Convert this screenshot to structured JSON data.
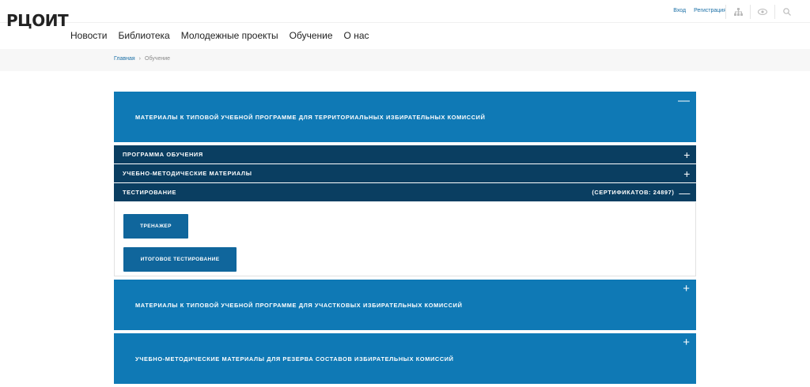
{
  "header": {
    "logo_text": "РЦОИТ",
    "nav": [
      "Новости",
      "Библиотека",
      "Молодежные проекты",
      "Обучение",
      "О нас"
    ],
    "login": "Вход",
    "register": "Регистрация",
    "icons": [
      "sitemap-icon",
      "eye-icon",
      "search-icon"
    ]
  },
  "breadcrumb": {
    "home": "Главная",
    "separator": "›",
    "current": "Обучение"
  },
  "sections": {
    "territorial": {
      "title": "МАТЕРИАЛЫ К ТИПОВОЙ УЧЕБНОЙ ПРОГРАММЕ ДЛЯ ТЕРРИТОРИАЛЬНЫХ ИЗБИРАТЕЛЬНЫХ КОМИССИЙ",
      "sign": "—"
    },
    "sub1": {
      "title": "ПРОГРАММА ОБУЧЕНИЯ",
      "sign": "+"
    },
    "sub2": {
      "title": "УЧЕБНО-МЕТОДИЧЕСКИЕ МАТЕРИАЛЫ",
      "sign": "+"
    },
    "sub3": {
      "title": "ТЕСТИРОВАНИЕ",
      "extra": "(СЕРТИФИКАТОВ: 24897)",
      "sign": "—"
    },
    "buttons": {
      "trainer": "ТРЕНАЖЕР",
      "final_test": "ИТОГОВОЕ ТЕСТИРОВАНИЕ"
    },
    "precinct": {
      "title": "МАТЕРИАЛЫ К ТИПОВОЙ УЧЕБНОЙ ПРОГРАММЕ ДЛЯ УЧАСТКОВЫХ ИЗБИРАТЕЛЬНЫХ КОМИССИЙ",
      "sign": "+"
    },
    "reserve": {
      "title": "УЧЕБНО-МЕТОДИЧЕСКИЕ МАТЕРИАЛЫ ДЛЯ РЕЗЕРВА СОСТАВОВ ИЗБИРАТЕЛЬНЫХ КОМИССИЙ",
      "sign": "+"
    }
  },
  "colors": {
    "primary": "#0f79b5",
    "dark": "#0a3e61",
    "button": "#10669c",
    "link": "#1a6fa6"
  }
}
